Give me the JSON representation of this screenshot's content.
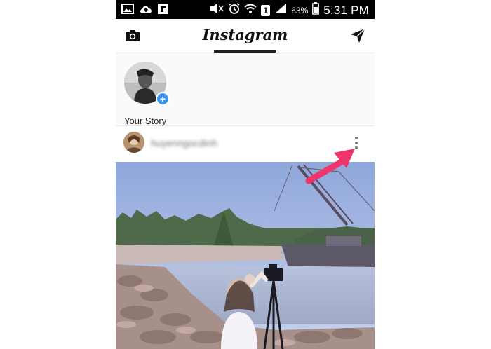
{
  "status_bar": {
    "left_icons": [
      "image-icon",
      "cloud-upload-icon",
      "flipboard-icon"
    ],
    "right_icons": [
      "mute-icon",
      "alarm-icon",
      "wifi-icon",
      "sim-icon",
      "signal-icon",
      "battery-icon"
    ],
    "sim_label": "1",
    "battery_percent": "63%",
    "time": "5:31 PM"
  },
  "app_bar": {
    "title": "Instagram",
    "left_icon": "camera-icon",
    "right_icon": "direct-message-icon"
  },
  "stories": {
    "items": [
      {
        "label": "Your Story",
        "badge_icon": "add-icon"
      }
    ]
  },
  "post": {
    "username": "huyenngocdinh",
    "menu_icon": "more-vertical-icon"
  },
  "colors": {
    "accent": "#3897f0",
    "annotation": "#f0346c",
    "status_bar": "#000000"
  }
}
